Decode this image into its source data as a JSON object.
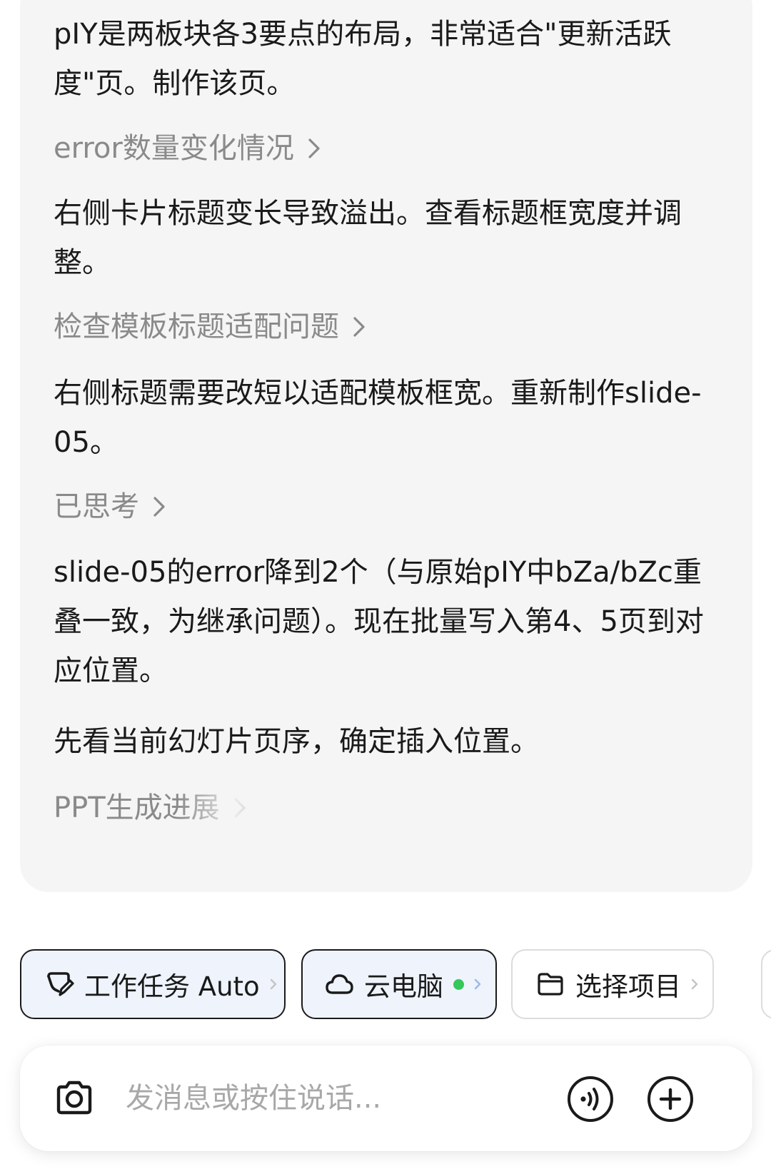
{
  "messages": {
    "text_1": "pIY是两板块各3要点的布局，非常适合\"更新活跃度\"页。制作该页。",
    "link_1": "error数量变化情况",
    "text_2": "右侧卡片标题变长导致溢出。查看标题框宽度并调整。",
    "link_2": "检查模板标题适配问题",
    "text_3": "右侧标题需要改短以适配模板框宽。重新制作slide-05。",
    "link_3": "已思考",
    "text_4": "slide-05的error降到2个（与原始pIY中bZa/bZc重叠一致，为继承问题）。现在批量写入第4、5页到对应位置。",
    "text_5": "先看当前幻灯片页序，确定插入位置。",
    "link_4": "PPT生成进展"
  },
  "toolbar": {
    "task_mode_label": "工作任务 Auto",
    "cloud_pc_label": "云电脑",
    "cloud_pc_status_color": "#34c759",
    "select_project_label": "选择项目",
    "accent_color": "#1a1a1a",
    "active_bg_color": "#eef3fc"
  },
  "composer": {
    "placeholder": "发消息或按住说话...",
    "camera_icon": "camera-icon",
    "voice_icon": "voice-call-icon",
    "add_icon": "plus-circle-icon"
  }
}
